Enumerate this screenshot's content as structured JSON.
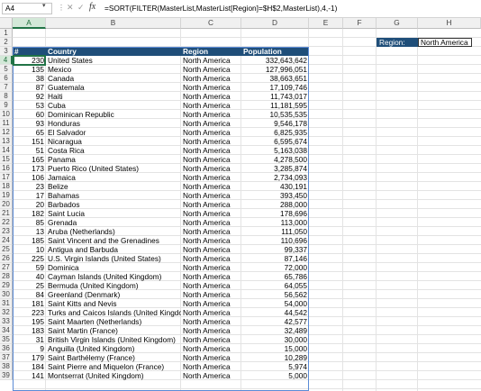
{
  "formula_bar": {
    "name_box": "A4",
    "fx_label": "fx",
    "formula": "=SORT(FILTER(MasterList,MasterList[Region]=$H$2,MasterList),4,-1)"
  },
  "columns": [
    "A",
    "B",
    "C",
    "D",
    "E",
    "F",
    "G",
    "H"
  ],
  "selected_column": "A",
  "selected_row": "4",
  "rows": [
    "1",
    "2",
    "3",
    "4",
    "5",
    "6",
    "7",
    "8",
    "9",
    "10",
    "11",
    "12",
    "13",
    "14",
    "15",
    "16",
    "17",
    "18",
    "19",
    "20",
    "21",
    "22",
    "23",
    "24",
    "25",
    "26",
    "27",
    "28",
    "29",
    "30",
    "31",
    "32",
    "33",
    "34",
    "35",
    "36",
    "37",
    "38",
    "39"
  ],
  "region_filter": {
    "label": "Region:",
    "value": "North America"
  },
  "table": {
    "headers": [
      "#",
      "Country",
      "Region",
      "Population"
    ],
    "rows": [
      [
        "230",
        "United States",
        "North America",
        "332,643,642"
      ],
      [
        "135",
        "Mexico",
        "North America",
        "127,996,051"
      ],
      [
        "38",
        "Canada",
        "North America",
        "38,663,651"
      ],
      [
        "87",
        "Guatemala",
        "North America",
        "17,109,746"
      ],
      [
        "92",
        "Haiti",
        "North America",
        "11,743,017"
      ],
      [
        "53",
        "Cuba",
        "North America",
        "11,181,595"
      ],
      [
        "60",
        "Dominican Republic",
        "North America",
        "10,535,535"
      ],
      [
        "93",
        "Honduras",
        "North America",
        "9,546,178"
      ],
      [
        "65",
        "El Salvador",
        "North America",
        "6,825,935"
      ],
      [
        "151",
        "Nicaragua",
        "North America",
        "6,595,674"
      ],
      [
        "51",
        "Costa Rica",
        "North America",
        "5,163,038"
      ],
      [
        "165",
        "Panama",
        "North America",
        "4,278,500"
      ],
      [
        "173",
        "Puerto Rico (United States)",
        "North America",
        "3,285,874"
      ],
      [
        "106",
        "Jamaica",
        "North America",
        "2,734,093"
      ],
      [
        "23",
        "Belize",
        "North America",
        "430,191"
      ],
      [
        "17",
        "Bahamas",
        "North America",
        "393,450"
      ],
      [
        "20",
        "Barbados",
        "North America",
        "288,000"
      ],
      [
        "182",
        "Saint Lucia",
        "North America",
        "178,696"
      ],
      [
        "85",
        "Grenada",
        "North America",
        "113,000"
      ],
      [
        "13",
        "Aruba (Netherlands)",
        "North America",
        "111,050"
      ],
      [
        "185",
        "Saint Vincent and the Grenadines",
        "North America",
        "110,696"
      ],
      [
        "10",
        "Antigua and Barbuda",
        "North America",
        "99,337"
      ],
      [
        "225",
        "U.S. Virgin Islands (United States)",
        "North America",
        "87,146"
      ],
      [
        "59",
        "Dominica",
        "North America",
        "72,000"
      ],
      [
        "40",
        "Cayman Islands (United Kingdom)",
        "North America",
        "65,786"
      ],
      [
        "25",
        "Bermuda (United Kingdom)",
        "North America",
        "64,055"
      ],
      [
        "84",
        "Greenland (Denmark)",
        "North America",
        "56,562"
      ],
      [
        "181",
        "Saint Kitts and Nevis",
        "North America",
        "54,000"
      ],
      [
        "223",
        "Turks and Caicos Islands (United Kingdo",
        "North America",
        "44,542"
      ],
      [
        "195",
        "Saint Maarten (Netherlands)",
        "North America",
        "42,577"
      ],
      [
        "183",
        "Saint Martin (France)",
        "North America",
        "32,489"
      ],
      [
        "31",
        "British Virgin Islands (United Kingdom)",
        "North America",
        "30,000"
      ],
      [
        "9",
        "Anguilla (United Kingdom)",
        "North America",
        "15,000"
      ],
      [
        "179",
        "Saint Barthélemy (France)",
        "North America",
        "10,289"
      ],
      [
        "184",
        "Saint Pierre and Miquelon (France)",
        "North America",
        "5,974"
      ],
      [
        "141",
        "Montserrat (United Kingdom)",
        "North America",
        "5,000"
      ]
    ]
  }
}
